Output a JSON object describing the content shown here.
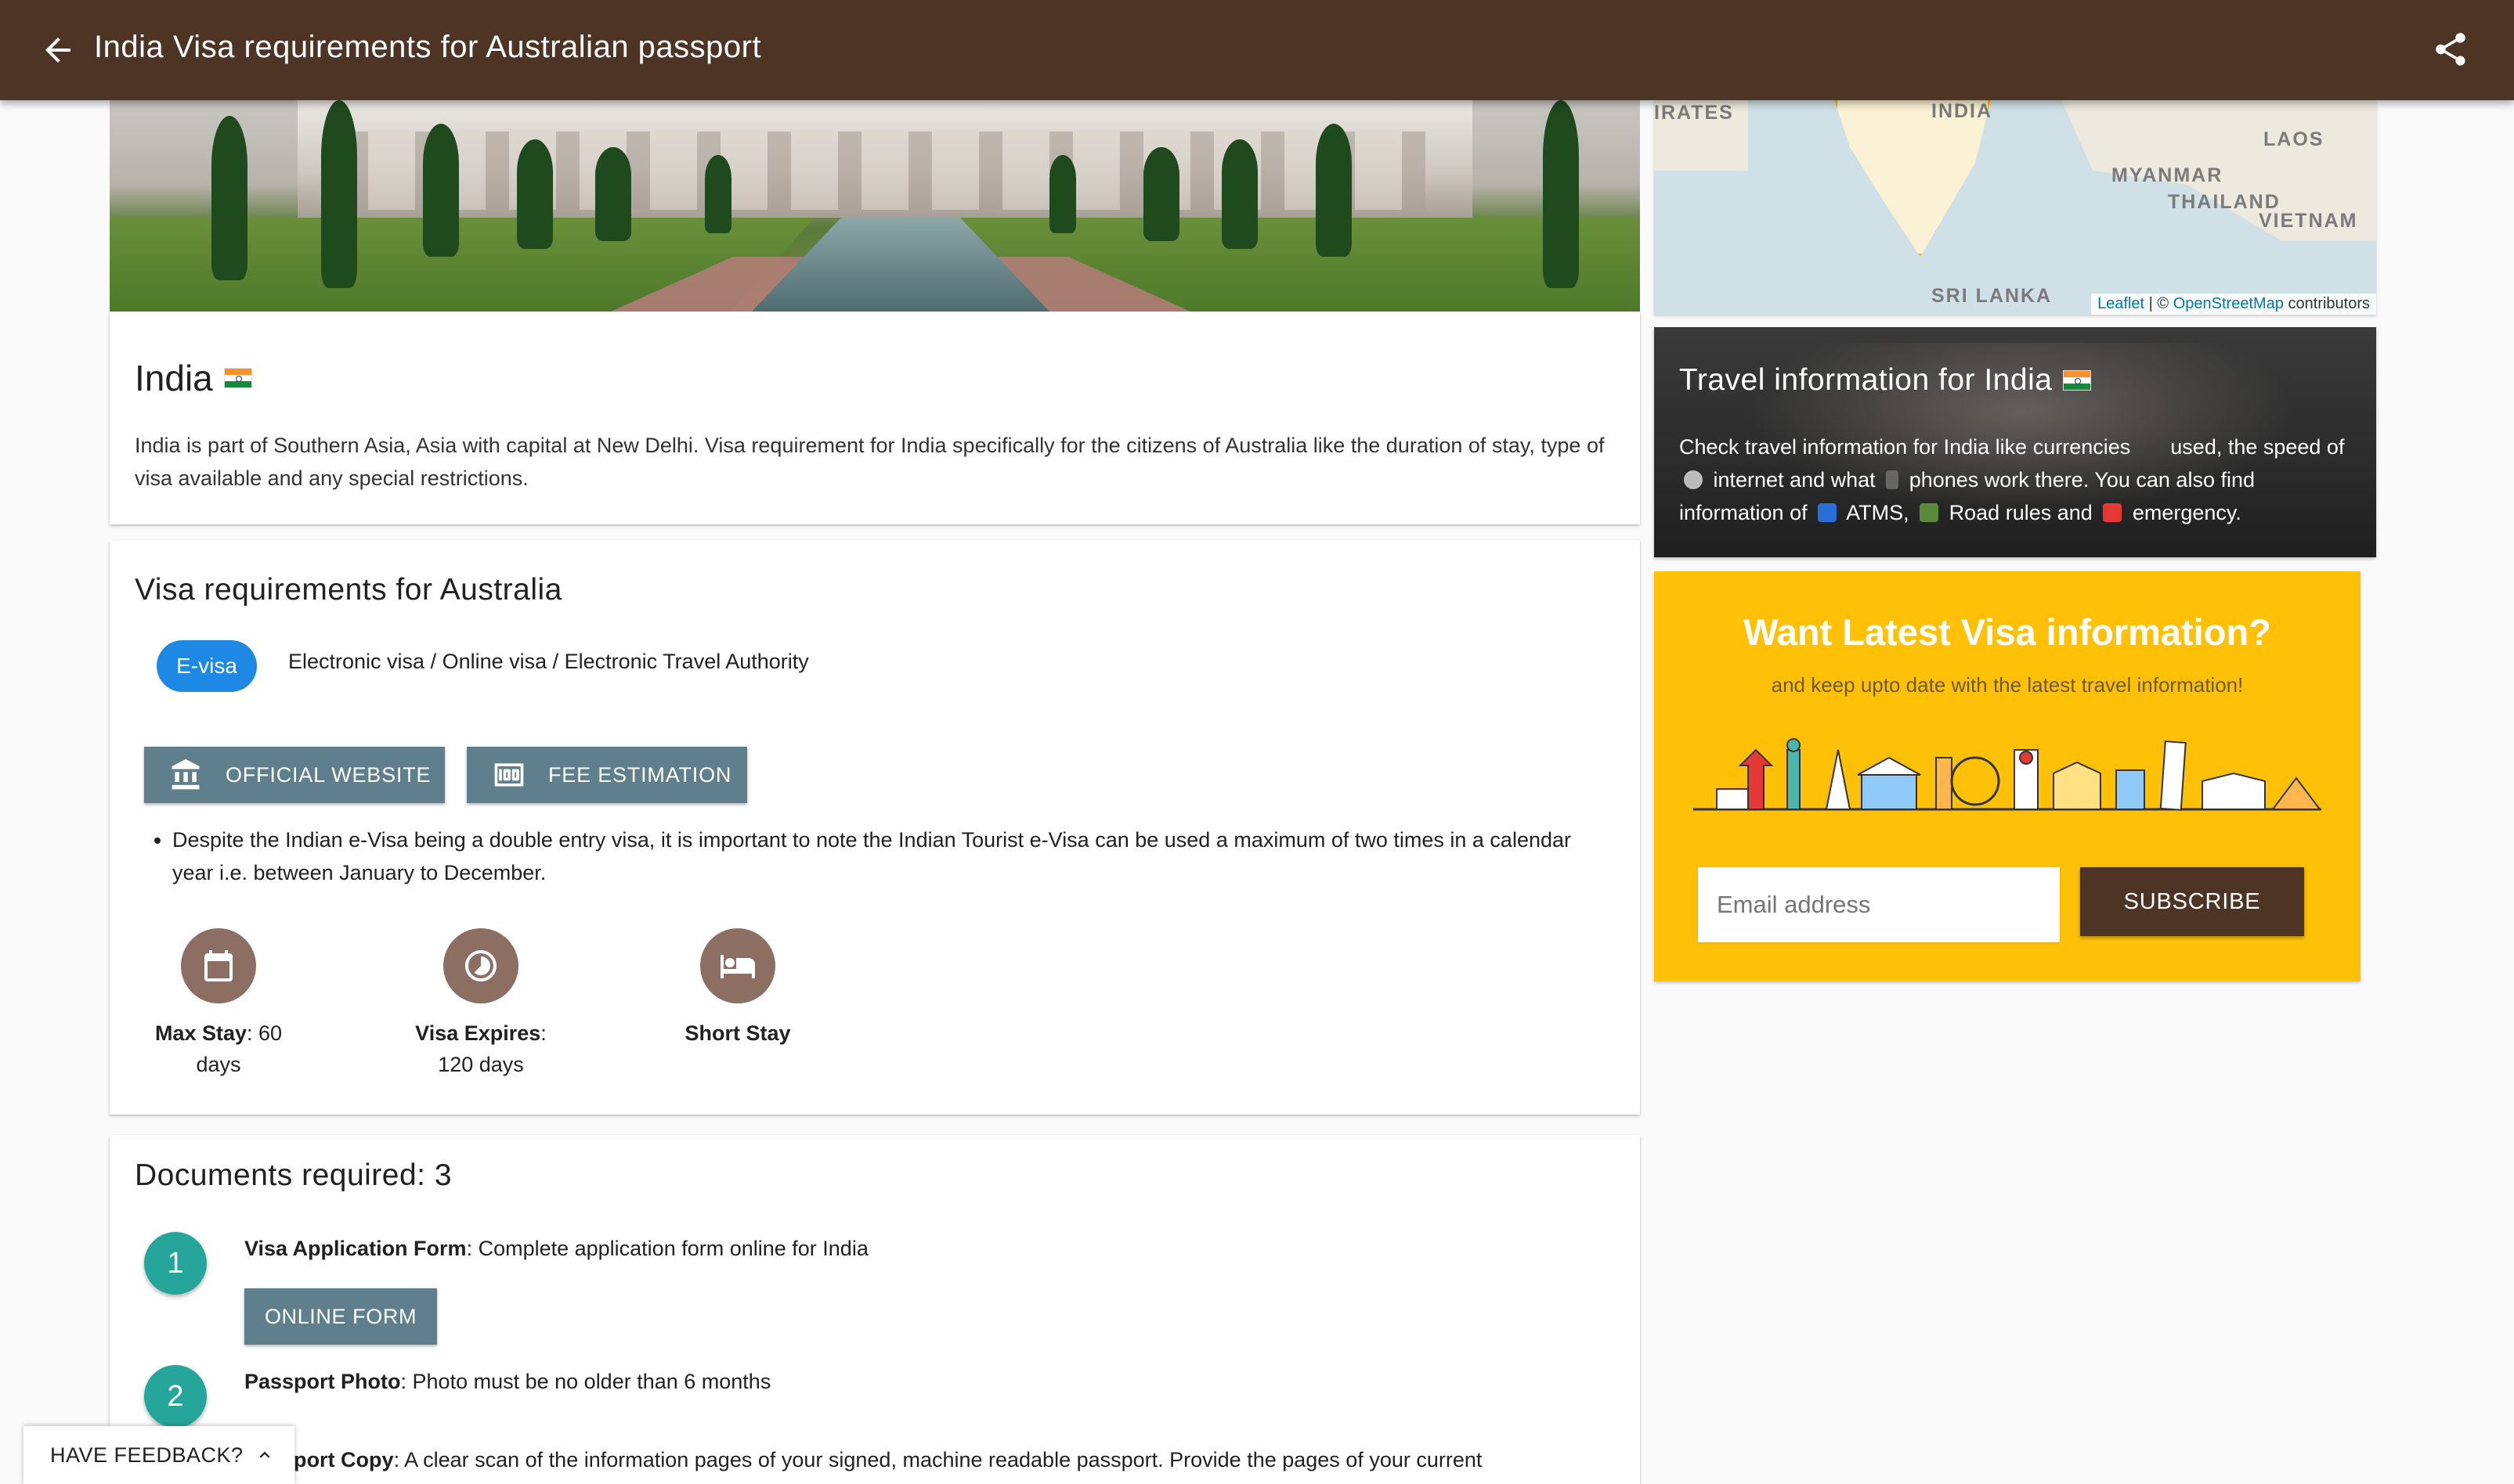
{
  "app_bar": {
    "title": "India Visa requirements for Australian passport",
    "background_color": "#4e3424",
    "back_icon": "arrow-back-icon",
    "share_icon": "share-icon"
  },
  "country_card": {
    "name": "India",
    "description": "India is part of Southern Asia, Asia with capital at New Delhi. Visa requirement for India specifically for the citizens of Australia like the duration of stay, type of visa available and any special restrictions."
  },
  "visa_card": {
    "title": "Visa requirements for Australia",
    "chip_label": "E-visa",
    "chip_color": "#1e88e5",
    "chip_description": "Electronic visa / Online visa / Electronic Travel Authority",
    "official_website_label": "OFFICIAL WEBSITE",
    "fee_estimation_label": "FEE ESTIMATION",
    "notes": [
      "Despite the Indian e-Visa being a double entry visa, it is important to note the Indian Tourist e-Visa can be used a maximum of two times in a calendar year i.e. between January to December."
    ],
    "stats": {
      "max_stay_label": "Max Stay",
      "max_stay_value": ": 60 days",
      "expires_label": "Visa Expires",
      "expires_value": ": 120 days",
      "stay_type": "Short Stay"
    }
  },
  "documents_card": {
    "title": "Documents required: 3",
    "items": [
      {
        "number": "1",
        "name": "Visa Application Form",
        "detail": ": Complete application form online for India",
        "button": "ONLINE FORM"
      },
      {
        "number": "2",
        "name": "Passport Photo",
        "detail": ": Photo must be no older than 6 months"
      },
      {
        "number": "3",
        "name": "ort Copy",
        "name_prefix": "Passp",
        "detail": ": A clear scan of the information pages of your signed, machine readable passport. Provide the pages of your current"
      }
    ],
    "step_color": "#26a69a"
  },
  "map": {
    "labels": {
      "emirates": "IRATES",
      "india": "INDIA",
      "laos": "LAOS",
      "myanmar": "MYANMAR",
      "thailand": "THAILAND",
      "vietnam": "VIETNAM",
      "sri_lanka": "SRI LANKA"
    },
    "attribution_leaflet": "Leaflet",
    "attribution_sep": " | © ",
    "attribution_osm": "OpenStreetMap",
    "attribution_tail": " contributors"
  },
  "travel_card": {
    "title": "Travel information for India",
    "text_1": "Check travel information for India like currencies",
    "text_2": "used, the speed of",
    "text_3": "internet and what",
    "text_4": "phones work there. You can also find information of",
    "text_5": "ATMS,",
    "text_6": "Road rules and",
    "text_7": "emergency."
  },
  "subscribe_card": {
    "title": "Want Latest Visa information?",
    "subtitle": "and keep upto date with the latest travel information!",
    "email_placeholder": "Email address",
    "button_label": "SUBSCRIBE",
    "background_color": "#ffc107"
  },
  "feedback": {
    "label": "HAVE FEEDBACK?"
  }
}
